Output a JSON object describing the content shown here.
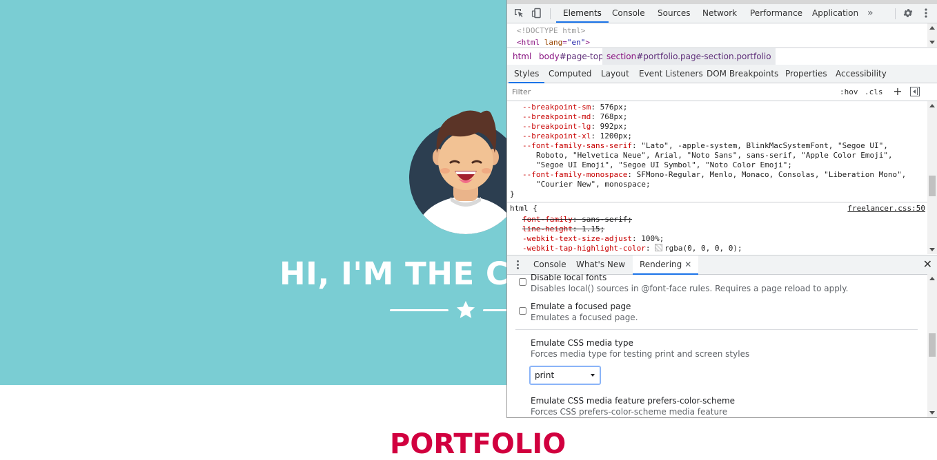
{
  "page": {
    "hero_title": "HI, I'M THE CI",
    "section_title": "PORTFOLIO",
    "colors": {
      "hero_bg": "#7acdd3",
      "section_title": "#d1003f"
    }
  },
  "devtools": {
    "main_tabs": [
      "Elements",
      "Console",
      "Sources",
      "Network",
      "Performance",
      "Application"
    ],
    "active_main_tab": "Elements",
    "more_tabs_glyph": "»",
    "dom": {
      "doctype": "<!DOCTYPE html>",
      "html_tag": "html",
      "html_attr": "lang",
      "html_attr_val": "\"en\""
    },
    "breadcrumbs": [
      {
        "tag": "html",
        "rest": ""
      },
      {
        "tag": "body",
        "rest": "#page-top"
      },
      {
        "tag": "section",
        "rest": "#portfolio.page-section.portfolio"
      }
    ],
    "sub_tabs": [
      "Styles",
      "Computed",
      "Layout",
      "Event Listeners",
      "DOM Breakpoints",
      "Properties",
      "Accessibility"
    ],
    "active_sub_tab": "Styles",
    "filter": {
      "placeholder": "Filter",
      "hov": ":hov",
      "cls": ".cls",
      "plus": "+"
    },
    "css_vars": [
      {
        "prop": "--breakpoint-sm",
        "value": "576px;"
      },
      {
        "prop": "--breakpoint-md",
        "value": "768px;"
      },
      {
        "prop": "--breakpoint-lg",
        "value": "992px;"
      },
      {
        "prop": "--breakpoint-xl",
        "value": "1200px;"
      }
    ],
    "font_sans": {
      "prop": "--font-family-sans-serif",
      "lines": [
        "\"Lato\", -apple-system, BlinkMacSystemFont, \"Segoe UI\",",
        "Roboto, \"Helvetica Neue\", Arial, \"Noto Sans\", sans-serif, \"Apple Color Emoji\",",
        "\"Segoe UI Emoji\", \"Segoe UI Symbol\", \"Noto Color Emoji\";"
      ]
    },
    "font_mono": {
      "prop": "--font-family-monospace",
      "lines": [
        "SFMono-Regular, Menlo, Monaco, Consolas, \"Liberation Mono\",",
        "\"Courier New\", monospace;"
      ]
    },
    "close_brace": "}",
    "html_rule": {
      "selector": "html {",
      "source": "freelancer.css:50",
      "decls": [
        {
          "prop": "font-family",
          "value": "sans-serif;",
          "struck": true
        },
        {
          "prop": "line-height",
          "value": "1.15;",
          "struck": true
        },
        {
          "prop": "-webkit-text-size-adjust",
          "value": "100%;",
          "struck": false
        },
        {
          "prop": "-webkit-tap-highlight-color",
          "value": "rgba(0, 0, 0, 0);",
          "struck": false
        }
      ]
    },
    "drawer_tabs": [
      "Console",
      "What's New",
      "Rendering"
    ],
    "active_drawer_tab": "Rendering",
    "rendering": {
      "disable_local_fonts": {
        "title": "Disable local fonts",
        "desc": "Disables local() sources in @font-face rules. Requires a page reload to apply.",
        "checked": false
      },
      "focused_page": {
        "title": "Emulate a focused page",
        "desc": "Emulates a focused page.",
        "checked": false
      },
      "media_type": {
        "title": "Emulate CSS media type",
        "desc": "Forces media type for testing print and screen styles",
        "value": "print"
      },
      "color_scheme": {
        "title": "Emulate CSS media feature prefers-color-scheme",
        "desc": "Forces CSS prefers-color-scheme media feature"
      }
    }
  }
}
